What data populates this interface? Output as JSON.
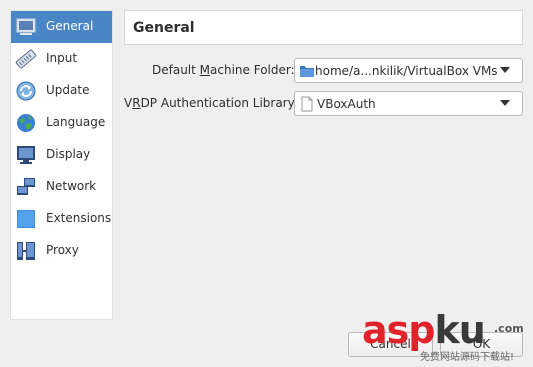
{
  "sidebar": {
    "items": [
      {
        "label": "General",
        "icon": "monitor-icon",
        "selected": true
      },
      {
        "label": "Input",
        "icon": "keyboard-icon",
        "selected": false
      },
      {
        "label": "Update",
        "icon": "refresh-icon",
        "selected": false
      },
      {
        "label": "Language",
        "icon": "globe-icon",
        "selected": false
      },
      {
        "label": "Display",
        "icon": "display-icon",
        "selected": false
      },
      {
        "label": "Network",
        "icon": "network-icon",
        "selected": false
      },
      {
        "label": "Extensions",
        "icon": "extension-icon",
        "selected": false
      },
      {
        "label": "Proxy",
        "icon": "proxy-icon",
        "selected": false
      }
    ]
  },
  "header": {
    "title": "General"
  },
  "form": {
    "machine_folder": {
      "label_pre": "Default ",
      "label_mnemonic": "M",
      "label_post": "achine Folder:",
      "value": "home/a...nkilik/VirtualBox VMs"
    },
    "vrdp_library": {
      "label_pre": "V",
      "label_mnemonic": "R",
      "label_post": "DP Authentication Library:",
      "value": "VBoxAuth"
    }
  },
  "buttons": {
    "cancel": "Cancel",
    "ok": "OK"
  },
  "watermark": {
    "main_a": "asp",
    "main_b": "ku",
    "suffix": ".com",
    "sub": "免费网站源码下载站!"
  },
  "colors": {
    "selection": "#4a86c6",
    "watermark_red": "#e0222a"
  }
}
